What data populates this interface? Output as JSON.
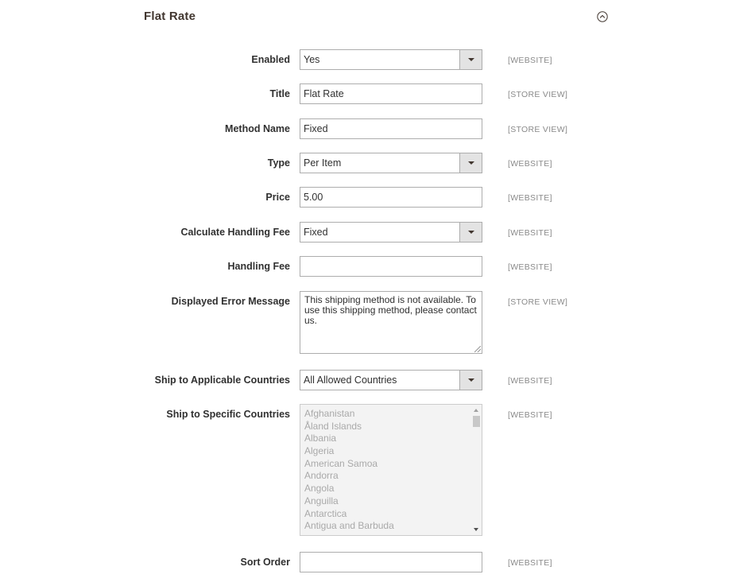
{
  "section": {
    "title": "Flat Rate"
  },
  "fields": {
    "enabled": {
      "label": "Enabled",
      "value": "Yes",
      "scope": "[WEBSITE]"
    },
    "title": {
      "label": "Title",
      "value": "Flat Rate",
      "scope": "[STORE VIEW]"
    },
    "method_name": {
      "label": "Method Name",
      "value": "Fixed",
      "scope": "[STORE VIEW]"
    },
    "type": {
      "label": "Type",
      "value": "Per Item",
      "scope": "[WEBSITE]"
    },
    "price": {
      "label": "Price",
      "value": "5.00",
      "scope": "[WEBSITE]"
    },
    "calc_handling": {
      "label": "Calculate Handling Fee",
      "value": "Fixed",
      "scope": "[WEBSITE]"
    },
    "handling_fee": {
      "label": "Handling Fee",
      "value": "",
      "scope": "[WEBSITE]"
    },
    "error_message": {
      "label": "Displayed Error Message",
      "value": "This shipping method is not available. To use this shipping method, please contact us.",
      "scope": "[STORE VIEW]"
    },
    "applicable_countries": {
      "label": "Ship to Applicable Countries",
      "value": "All Allowed Countries",
      "scope": "[WEBSITE]"
    },
    "specific_countries": {
      "label": "Ship to Specific Countries",
      "scope": "[WEBSITE]",
      "options": [
        "Afghanistan",
        "Åland Islands",
        "Albania",
        "Algeria",
        "American Samoa",
        "Andorra",
        "Angola",
        "Anguilla",
        "Antarctica",
        "Antigua and Barbuda"
      ]
    },
    "sort_order": {
      "label": "Sort Order",
      "value": "",
      "scope": "[WEBSITE]"
    }
  },
  "icons": {
    "collapse": "chevron-up-circle-icon",
    "dropdown": "caret-down-icon"
  },
  "colors": {
    "label": "#303030",
    "scope": "#8a8a8a",
    "border": "#adadad",
    "disabled_bg": "#f3f3f3",
    "select_button": "#e3e3e3"
  }
}
